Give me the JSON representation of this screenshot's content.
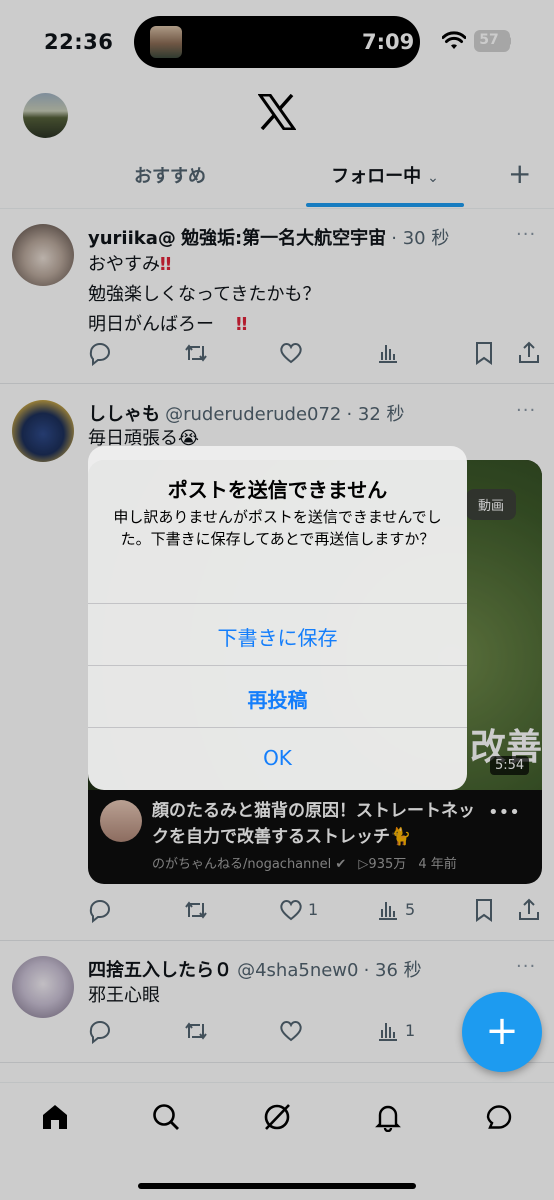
{
  "status_bar": {
    "time": "22:36",
    "island_timer": "7:09",
    "battery": "57"
  },
  "header": {
    "logo_icon": "x-logo-icon",
    "tabs": [
      {
        "label": "おすすめ",
        "active": false
      },
      {
        "label": "フォロー中",
        "active": true
      }
    ],
    "add_icon": "plus-icon"
  },
  "posts": [
    {
      "name": "yuriika@",
      "handle_display": "勉強垢:第一名大航空宇宙",
      "time": "· 30 秒",
      "lines": [
        "おやすみ",
        "勉強楽しくなってきたかも？",
        "明日がんばろー"
      ],
      "bang": "‼",
      "counts": {
        "reply": "",
        "repost": "",
        "like": "",
        "views": ""
      }
    },
    {
      "name": "ししゃも",
      "handle": "@ruderuderude072",
      "time": "· 32 秒",
      "text": "毎日頑張る😭",
      "counts": {
        "reply": "",
        "repost": "",
        "like": "1",
        "views": "5"
      },
      "video": {
        "chip": "動画",
        "overlay_text": "改善",
        "duration": "5:54",
        "title": "顔のたるみと猫背の原因！ストレートネックを自力で改善するストレッチ🐈",
        "channel": "のがちゃんねる/nogachannel",
        "views": "▷935万",
        "age": "4 年前"
      }
    },
    {
      "name": "四捨五入したら０",
      "handle": "@4sha5new0",
      "time": "· 36 秒",
      "text": "邪王心眼",
      "counts": {
        "reply": "",
        "repost": "",
        "like": "",
        "views": "1"
      }
    }
  ],
  "alert": {
    "title": "ポストを送信できません",
    "message": "申し訳ありませんがポストを送信できませんでした。下書きに保存してあとで再送信しますか？",
    "buttons": [
      "下書きに保存",
      "再投稿",
      "OK"
    ]
  },
  "bottom_nav": {
    "items": [
      "home-icon",
      "search-icon",
      "grok-icon",
      "bell-icon",
      "messages-icon"
    ]
  },
  "colors": {
    "accent": "#1d9bf0",
    "ios_blue": "#147efb",
    "text": "#0f1419",
    "secondary": "#536471"
  }
}
